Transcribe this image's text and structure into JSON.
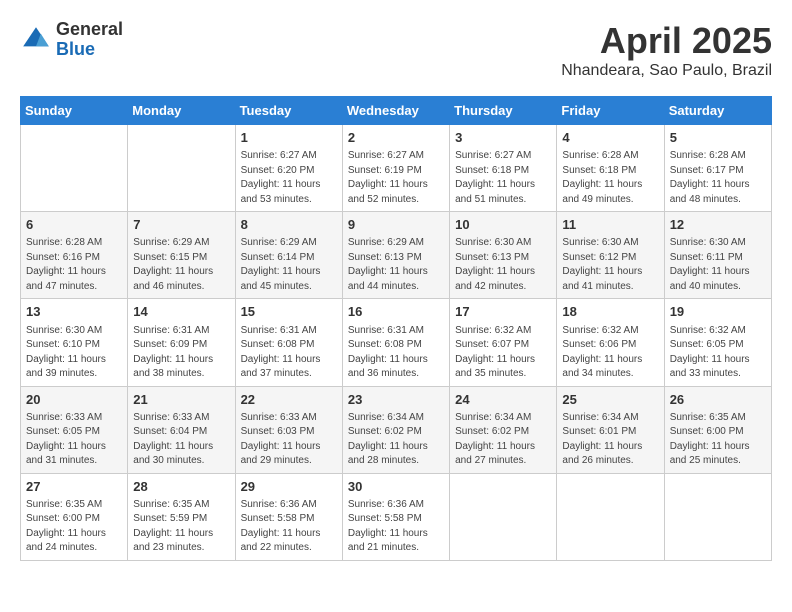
{
  "header": {
    "logo_general": "General",
    "logo_blue": "Blue",
    "main_title": "April 2025",
    "subtitle": "Nhandeara, Sao Paulo, Brazil"
  },
  "calendar": {
    "days_of_week": [
      "Sunday",
      "Monday",
      "Tuesday",
      "Wednesday",
      "Thursday",
      "Friday",
      "Saturday"
    ],
    "weeks": [
      [
        {
          "day": "",
          "info": ""
        },
        {
          "day": "",
          "info": ""
        },
        {
          "day": "1",
          "info": "Sunrise: 6:27 AM\nSunset: 6:20 PM\nDaylight: 11 hours and 53 minutes."
        },
        {
          "day": "2",
          "info": "Sunrise: 6:27 AM\nSunset: 6:19 PM\nDaylight: 11 hours and 52 minutes."
        },
        {
          "day": "3",
          "info": "Sunrise: 6:27 AM\nSunset: 6:18 PM\nDaylight: 11 hours and 51 minutes."
        },
        {
          "day": "4",
          "info": "Sunrise: 6:28 AM\nSunset: 6:18 PM\nDaylight: 11 hours and 49 minutes."
        },
        {
          "day": "5",
          "info": "Sunrise: 6:28 AM\nSunset: 6:17 PM\nDaylight: 11 hours and 48 minutes."
        }
      ],
      [
        {
          "day": "6",
          "info": "Sunrise: 6:28 AM\nSunset: 6:16 PM\nDaylight: 11 hours and 47 minutes."
        },
        {
          "day": "7",
          "info": "Sunrise: 6:29 AM\nSunset: 6:15 PM\nDaylight: 11 hours and 46 minutes."
        },
        {
          "day": "8",
          "info": "Sunrise: 6:29 AM\nSunset: 6:14 PM\nDaylight: 11 hours and 45 minutes."
        },
        {
          "day": "9",
          "info": "Sunrise: 6:29 AM\nSunset: 6:13 PM\nDaylight: 11 hours and 44 minutes."
        },
        {
          "day": "10",
          "info": "Sunrise: 6:30 AM\nSunset: 6:13 PM\nDaylight: 11 hours and 42 minutes."
        },
        {
          "day": "11",
          "info": "Sunrise: 6:30 AM\nSunset: 6:12 PM\nDaylight: 11 hours and 41 minutes."
        },
        {
          "day": "12",
          "info": "Sunrise: 6:30 AM\nSunset: 6:11 PM\nDaylight: 11 hours and 40 minutes."
        }
      ],
      [
        {
          "day": "13",
          "info": "Sunrise: 6:30 AM\nSunset: 6:10 PM\nDaylight: 11 hours and 39 minutes."
        },
        {
          "day": "14",
          "info": "Sunrise: 6:31 AM\nSunset: 6:09 PM\nDaylight: 11 hours and 38 minutes."
        },
        {
          "day": "15",
          "info": "Sunrise: 6:31 AM\nSunset: 6:08 PM\nDaylight: 11 hours and 37 minutes."
        },
        {
          "day": "16",
          "info": "Sunrise: 6:31 AM\nSunset: 6:08 PM\nDaylight: 11 hours and 36 minutes."
        },
        {
          "day": "17",
          "info": "Sunrise: 6:32 AM\nSunset: 6:07 PM\nDaylight: 11 hours and 35 minutes."
        },
        {
          "day": "18",
          "info": "Sunrise: 6:32 AM\nSunset: 6:06 PM\nDaylight: 11 hours and 34 minutes."
        },
        {
          "day": "19",
          "info": "Sunrise: 6:32 AM\nSunset: 6:05 PM\nDaylight: 11 hours and 33 minutes."
        }
      ],
      [
        {
          "day": "20",
          "info": "Sunrise: 6:33 AM\nSunset: 6:05 PM\nDaylight: 11 hours and 31 minutes."
        },
        {
          "day": "21",
          "info": "Sunrise: 6:33 AM\nSunset: 6:04 PM\nDaylight: 11 hours and 30 minutes."
        },
        {
          "day": "22",
          "info": "Sunrise: 6:33 AM\nSunset: 6:03 PM\nDaylight: 11 hours and 29 minutes."
        },
        {
          "day": "23",
          "info": "Sunrise: 6:34 AM\nSunset: 6:02 PM\nDaylight: 11 hours and 28 minutes."
        },
        {
          "day": "24",
          "info": "Sunrise: 6:34 AM\nSunset: 6:02 PM\nDaylight: 11 hours and 27 minutes."
        },
        {
          "day": "25",
          "info": "Sunrise: 6:34 AM\nSunset: 6:01 PM\nDaylight: 11 hours and 26 minutes."
        },
        {
          "day": "26",
          "info": "Sunrise: 6:35 AM\nSunset: 6:00 PM\nDaylight: 11 hours and 25 minutes."
        }
      ],
      [
        {
          "day": "27",
          "info": "Sunrise: 6:35 AM\nSunset: 6:00 PM\nDaylight: 11 hours and 24 minutes."
        },
        {
          "day": "28",
          "info": "Sunrise: 6:35 AM\nSunset: 5:59 PM\nDaylight: 11 hours and 23 minutes."
        },
        {
          "day": "29",
          "info": "Sunrise: 6:36 AM\nSunset: 5:58 PM\nDaylight: 11 hours and 22 minutes."
        },
        {
          "day": "30",
          "info": "Sunrise: 6:36 AM\nSunset: 5:58 PM\nDaylight: 11 hours and 21 minutes."
        },
        {
          "day": "",
          "info": ""
        },
        {
          "day": "",
          "info": ""
        },
        {
          "day": "",
          "info": ""
        }
      ]
    ]
  }
}
